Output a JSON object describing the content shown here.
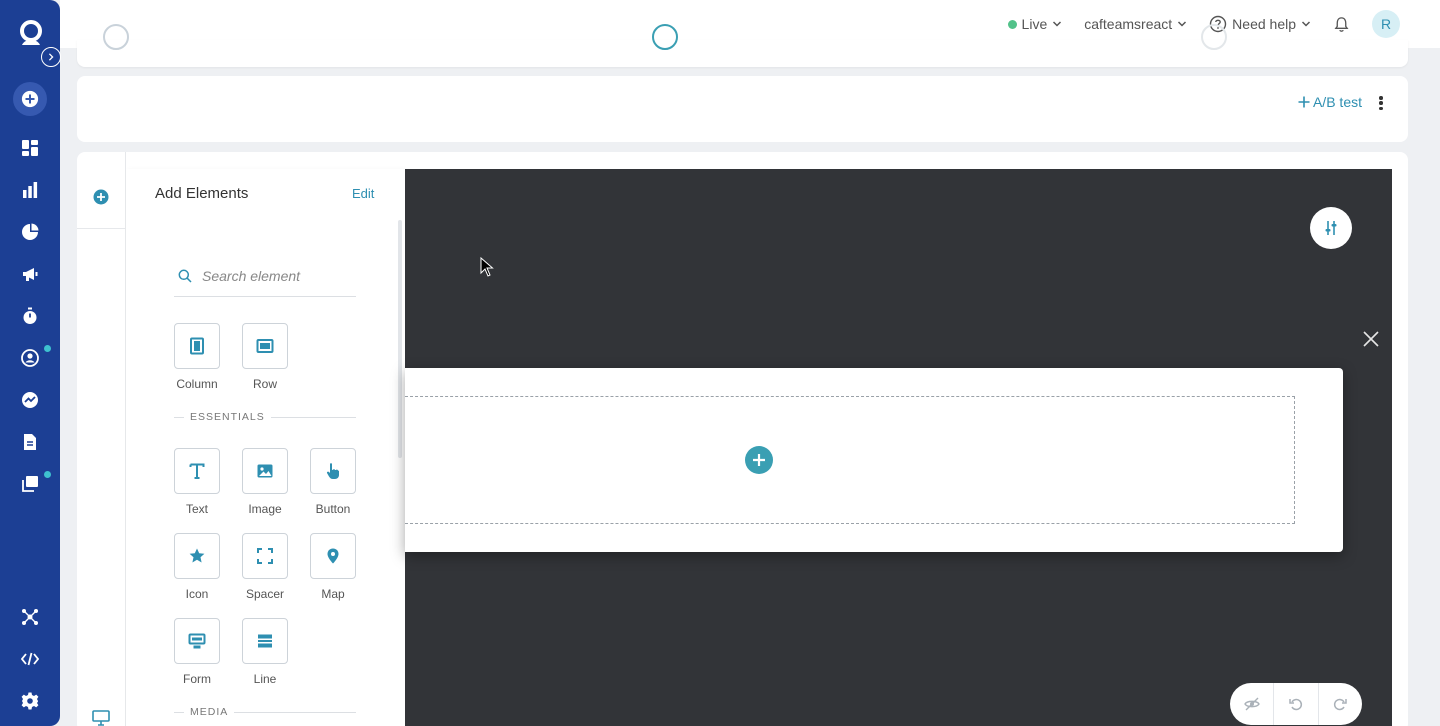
{
  "header": {
    "status_label": "Live",
    "account_label": "cafteamsreact",
    "help_label": "Need help",
    "avatar_initial": "R"
  },
  "ab_card": {
    "ab_test_label": "A/B test"
  },
  "panel": {
    "title": "Add Elements",
    "edit_label": "Edit",
    "search_placeholder": "Search element",
    "layout_elements": [
      {
        "label": "Column",
        "icon": "column-icon"
      },
      {
        "label": "Row",
        "icon": "row-icon"
      }
    ],
    "essentials_heading": "ESSENTIALS",
    "essential_elements": [
      {
        "label": "Text",
        "icon": "text-icon"
      },
      {
        "label": "Image",
        "icon": "image-icon"
      },
      {
        "label": "Button",
        "icon": "hand-pointer-icon"
      },
      {
        "label": "Icon",
        "icon": "star-icon"
      },
      {
        "label": "Spacer",
        "icon": "spacer-icon"
      },
      {
        "label": "Map",
        "icon": "map-pin-icon"
      },
      {
        "label": "Form",
        "icon": "form-icon"
      },
      {
        "label": "Line",
        "icon": "line-icon"
      }
    ],
    "media_heading": "MEDIA"
  },
  "colors": {
    "nav_bg": "#1c3f94",
    "accent": "#2e8fb1",
    "live": "#52c28a",
    "canvas_bg": "#323438",
    "add_circle": "#3a9fb3"
  }
}
